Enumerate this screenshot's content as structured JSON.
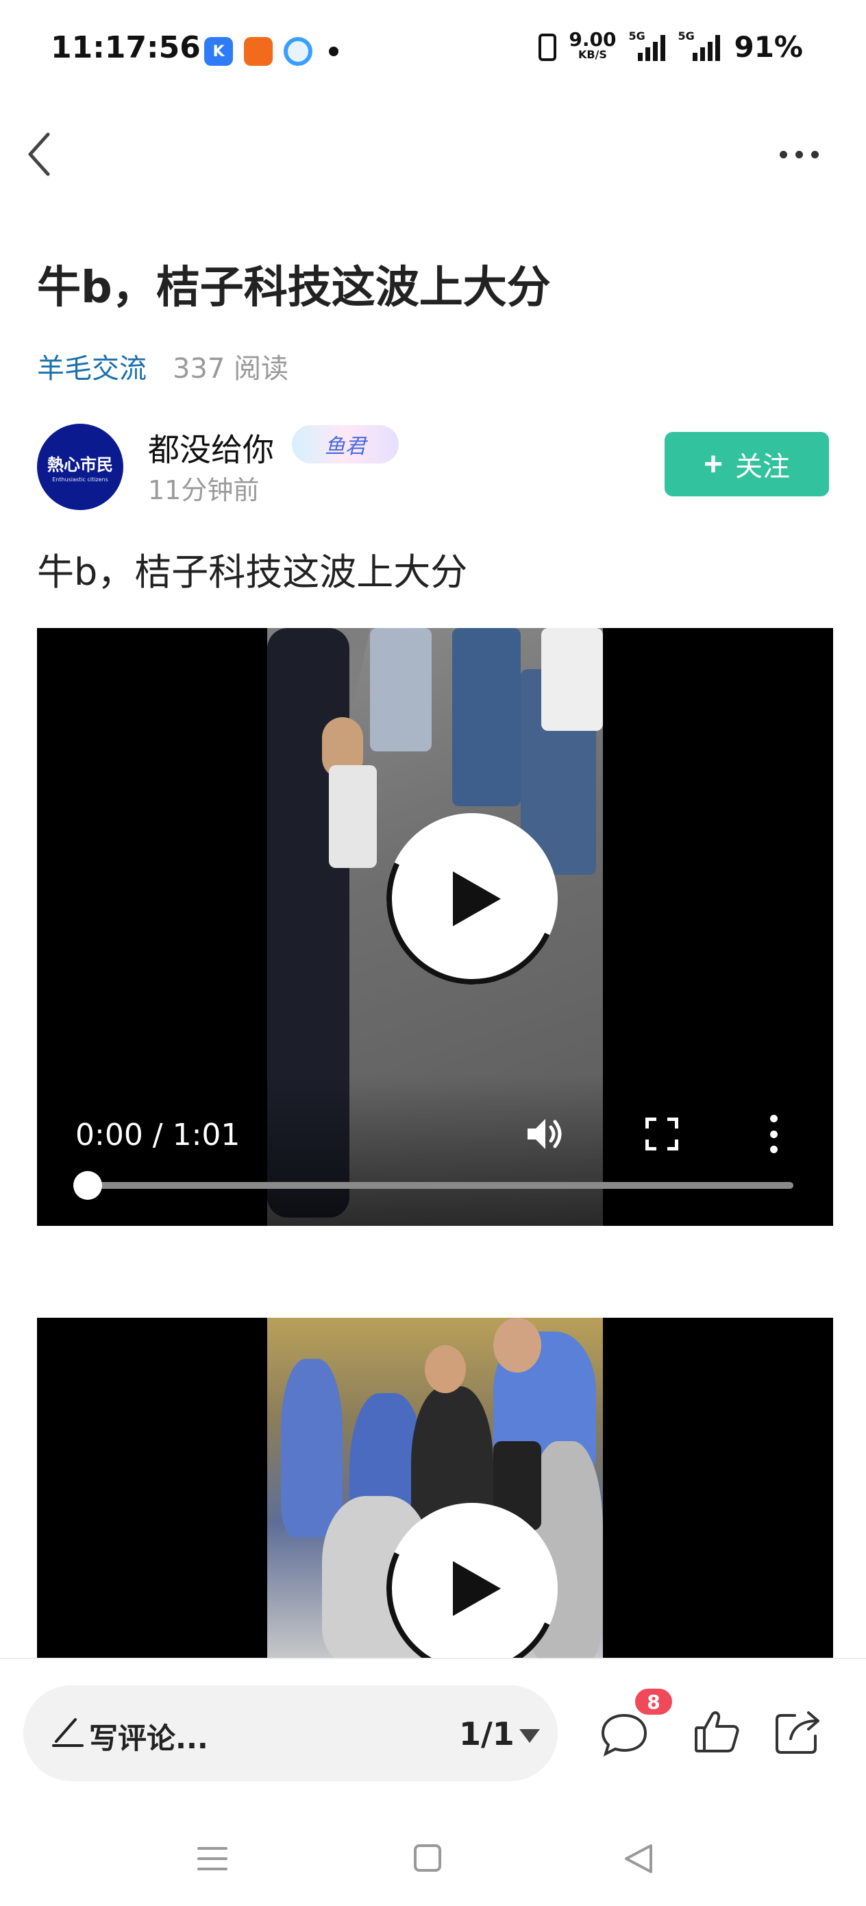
{
  "status_bar": {
    "time": "11:17:56",
    "speed_value": "9.00",
    "speed_unit": "KB/S",
    "network_1": "5G",
    "network_2": "5G",
    "battery": "91%",
    "app_icons": [
      "kugou-icon",
      "orange-app-icon",
      "cloud-app-icon"
    ]
  },
  "article": {
    "title": "牛b，桔子科技这波上大分",
    "category": "羊毛交流",
    "reads": "337 阅读",
    "body": "牛b，桔子科技这波上大分"
  },
  "author": {
    "name": "都没给你",
    "avatar_text": "熱心市民",
    "avatar_subtext": "Enthusiastic citizens",
    "badge_text": "鱼君",
    "time": "11分钟前",
    "follow_label": "关注"
  },
  "video_1": {
    "time_display": "0:00 / 1:01",
    "progress": 0
  },
  "bottom_bar": {
    "comment_placeholder": "写评论...",
    "page_count": "1/1",
    "comment_count": "8"
  },
  "colors": {
    "accent_green": "#32c29d",
    "link_blue": "#1b6fae",
    "badge_red": "#f04a5a"
  }
}
